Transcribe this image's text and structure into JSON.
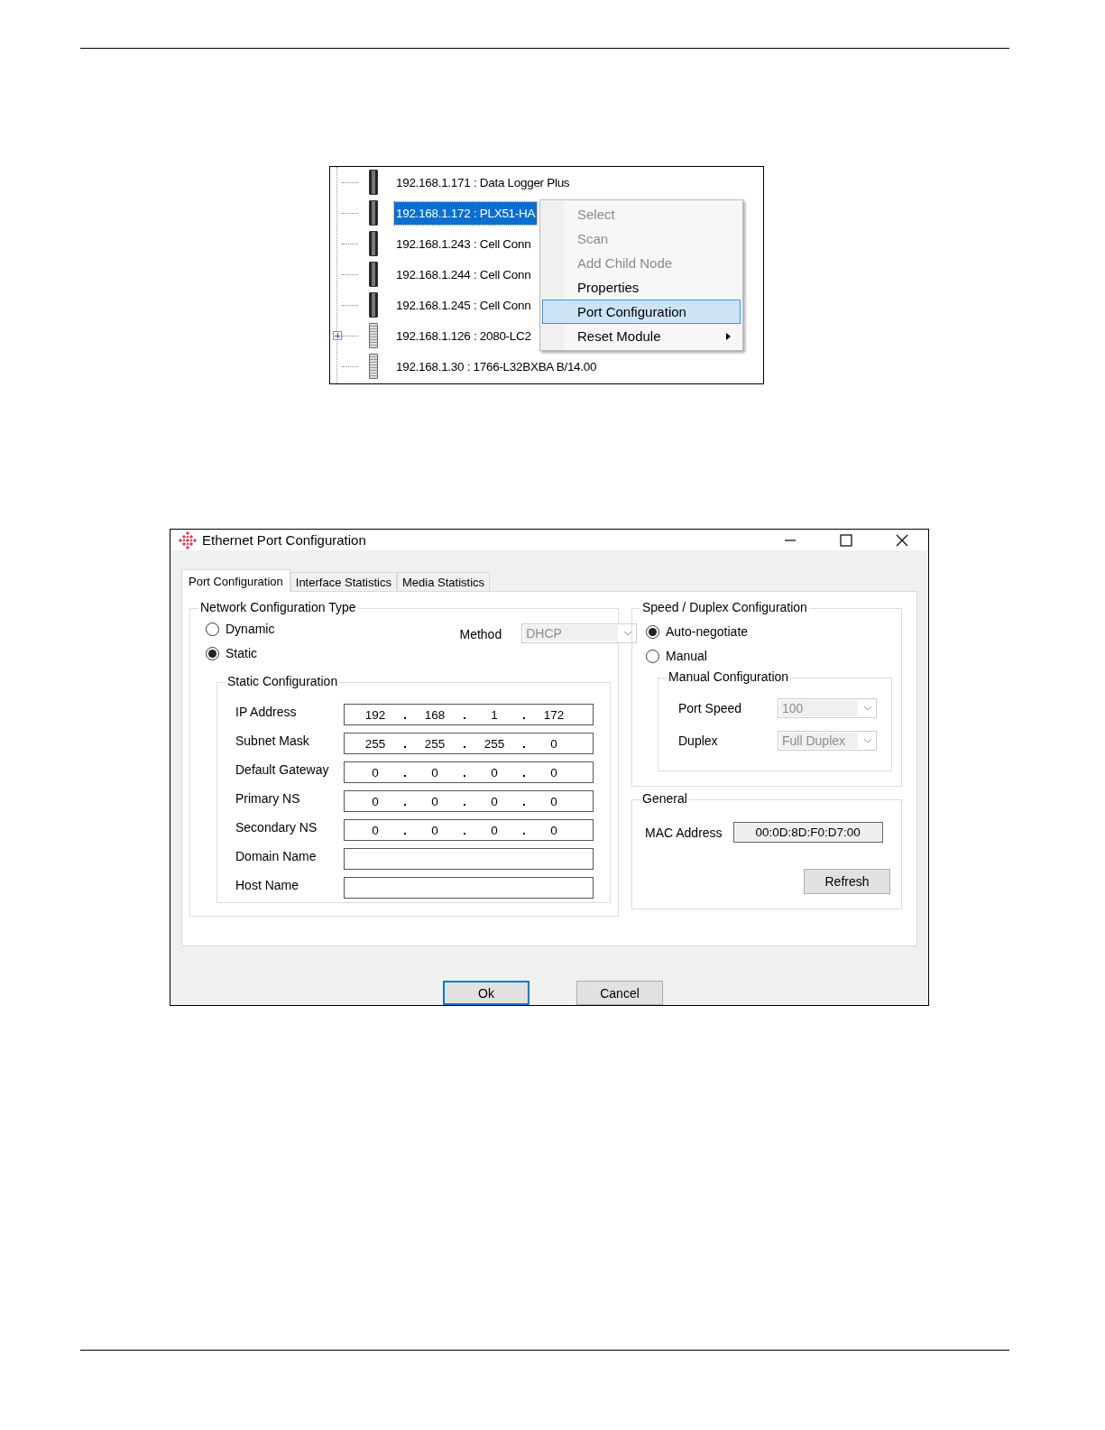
{
  "tree": {
    "rows": [
      {
        "label": "192.168.1.171 : Data Logger Plus",
        "kind": "module",
        "expandable": false,
        "selected": false
      },
      {
        "label": "192.168.1.172 : PLX51-HA",
        "kind": "module",
        "expandable": false,
        "selected": true
      },
      {
        "label": "192.168.1.243 : Cell Conn",
        "kind": "module",
        "expandable": false,
        "selected": false
      },
      {
        "label": "192.168.1.244 : Cell Conn",
        "kind": "module",
        "expandable": false,
        "selected": false
      },
      {
        "label": "192.168.1.245 : Cell Conn",
        "kind": "module",
        "expandable": false,
        "selected": false
      },
      {
        "label": "192.168.1.126 : 2080-LC2",
        "kind": "rack",
        "expandable": true,
        "selected": false
      },
      {
        "label": "192.168.1.30 : 1766-L32BXBA B/14.00",
        "kind": "rack",
        "expandable": false,
        "selected": false
      }
    ]
  },
  "context_menu": {
    "items": [
      {
        "label": "Select",
        "disabled": true,
        "selected": false,
        "submenu": false
      },
      {
        "label": "Scan",
        "disabled": true,
        "selected": false,
        "submenu": false
      },
      {
        "label": "Add Child Node",
        "disabled": true,
        "selected": false,
        "submenu": false
      },
      {
        "label": "Properties",
        "disabled": false,
        "selected": false,
        "submenu": false
      },
      {
        "label": "Port Configuration",
        "disabled": false,
        "selected": true,
        "submenu": false
      },
      {
        "label": "Reset Module",
        "disabled": false,
        "selected": false,
        "submenu": true
      }
    ]
  },
  "window": {
    "title": "Ethernet Port Configuration"
  },
  "tabs": [
    {
      "label": "Port Configuration",
      "selected": true
    },
    {
      "label": "Interface Statistics",
      "selected": false
    },
    {
      "label": "Media Statistics",
      "selected": false
    }
  ],
  "network_config": {
    "title": "Network Configuration Type",
    "options": [
      {
        "label": "Dynamic",
        "selected": false
      },
      {
        "label": "Static",
        "selected": true
      }
    ],
    "method": {
      "label": "Method",
      "value": "DHCP",
      "disabled": true
    },
    "static_config": {
      "title": "Static Configuration",
      "fields": [
        {
          "label": "IP Address",
          "kind": "ip",
          "octets": [
            "192",
            "168",
            "1",
            "172"
          ]
        },
        {
          "label": "Subnet Mask",
          "kind": "ip",
          "octets": [
            "255",
            "255",
            "255",
            "0"
          ]
        },
        {
          "label": "Default Gateway",
          "kind": "ip",
          "octets": [
            "0",
            "0",
            "0",
            "0"
          ]
        },
        {
          "label": "Primary NS",
          "kind": "ip",
          "octets": [
            "0",
            "0",
            "0",
            "0"
          ]
        },
        {
          "label": "Secondary NS",
          "kind": "ip",
          "octets": [
            "0",
            "0",
            "0",
            "0"
          ]
        },
        {
          "label": "Domain Name",
          "kind": "text"
        },
        {
          "label": "Host Name",
          "kind": "text"
        }
      ]
    }
  },
  "speed_duplex": {
    "title": "Speed / Duplex Configuration",
    "options": [
      {
        "label": "Auto-negotiate",
        "selected": true
      },
      {
        "label": "Manual",
        "selected": false
      }
    ],
    "manual_config": {
      "title": "Manual Configuration",
      "fields": [
        {
          "label": "Port Speed",
          "value": "100",
          "disabled": true
        },
        {
          "label": "Duplex",
          "value": "Full Duplex",
          "disabled": true
        }
      ]
    }
  },
  "general": {
    "title": "General",
    "mac_label": "MAC Address",
    "mac_value": "00:0D:8D:F0:D7:00",
    "refresh": "Refresh"
  },
  "buttons": [
    {
      "label": "Ok",
      "default": true
    },
    {
      "label": "Cancel",
      "default": false
    }
  ]
}
